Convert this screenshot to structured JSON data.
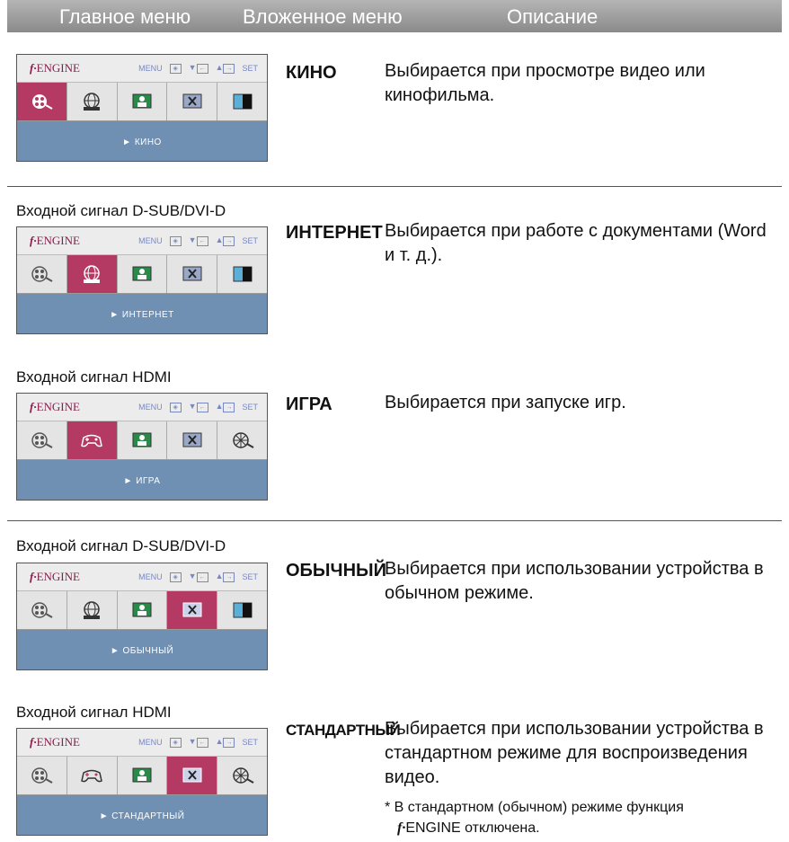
{
  "header": {
    "col_main": "Главное меню",
    "col_sub": "Вложенное меню",
    "col_desc": "Описание"
  },
  "osd": {
    "brand": "ENGINE",
    "brand_f": "f·",
    "nav_menu": "MENU",
    "nav_set": "SET"
  },
  "rows": [
    {
      "caption": "",
      "mode": "КИНО",
      "label": "► КИНО",
      "desc": "Выбирается при просмотре видео или кинофильма."
    },
    {
      "caption": "Входной сигнал D-SUB/DVI-D",
      "mode": "ИНТЕРНЕТ",
      "label": "► ИНТЕРНЕТ",
      "desc": "Выбирается при работе с документами (Word и т. д.)."
    },
    {
      "caption": "Входной сигнал HDMI",
      "mode": "ИГРА",
      "label": "► ИГРА",
      "desc": "Выбирается при запуске игр."
    },
    {
      "caption": "Входной сигнал D-SUB/DVI-D",
      "mode": "ОБЫЧНЫЙ",
      "label": "► ОБЫЧНЫЙ",
      "desc": "Выбирается при использовании устройства в обычном режиме."
    },
    {
      "caption": "Входной сигнал HDMI",
      "mode": "СТАНДАРТНЫЙ",
      "label": "► СТАНДАРТНЫЙ",
      "desc": "Выбирается при использовании устройства в стандартном режиме для воспроизведения видео."
    }
  ],
  "note": {
    "text": "* В стандартном (обычном) режиме функция",
    "suffix": "ENGINE отключена.",
    "f": "f·"
  }
}
